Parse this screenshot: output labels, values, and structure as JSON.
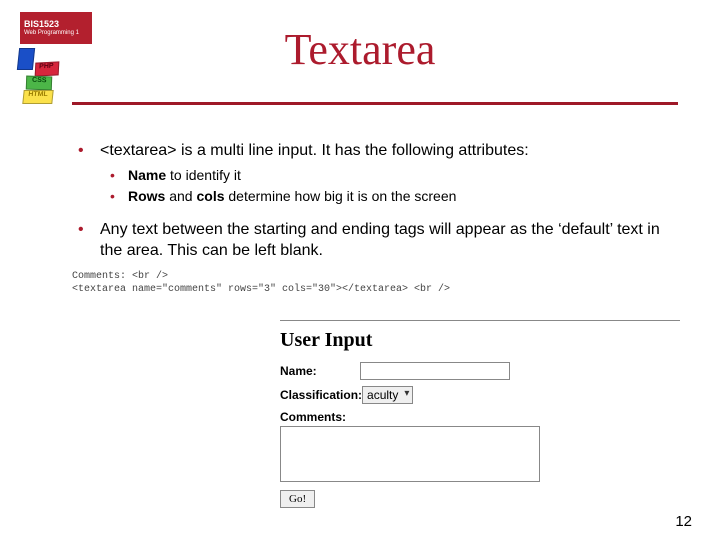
{
  "course": {
    "code": "BIS1523",
    "name": "Web Programming 1"
  },
  "blocks": {
    "php": "PHP",
    "css": "CSS",
    "html": "HTML"
  },
  "title": "Textarea",
  "bullets": {
    "b1_pre": "<textarea> is a multi line input.  It has the following attributes:",
    "s1_bold": "Name",
    "s1_rest": " to identify it",
    "s2_bold1": "Rows",
    "s2_mid": " and ",
    "s2_bold2": "cols",
    "s2_rest": " determine how big it is on the screen",
    "b2": "Any text between the starting and ending tags will appear as the ‘default’ text in the area.  This can be left blank."
  },
  "code": {
    "l1": "Comments: <br />",
    "l2": "<textarea name=\"comments\" rows=\"3\" cols=\"30\"></textarea> <br />"
  },
  "form": {
    "heading": "User Input",
    "name_label": "Name:",
    "class_label": "Classification:",
    "class_value": "aculty",
    "comments_label": "Comments:",
    "go": "Go!"
  },
  "page": "12"
}
